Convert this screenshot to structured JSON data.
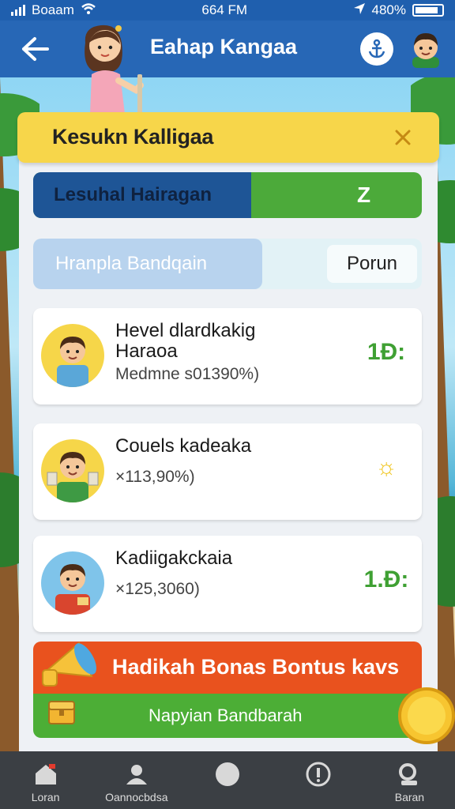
{
  "status_bar": {
    "carrier": "Boaam",
    "time": "664 FM",
    "battery": "480%"
  },
  "header": {
    "title": "Eahap Kangaa",
    "back_icon": "arrow-left-icon",
    "action_icon": "anchor-icon",
    "profile_icon": "boy-avatar-icon"
  },
  "panel": {
    "title": "Kesukn Kalligaa",
    "close_icon": "close-icon",
    "progress_primary": {
      "label": "Lesuhal Hairagan",
      "value": "Z",
      "fill_fraction": 0.56,
      "colors": {
        "fill": "#1e5596",
        "track": "#4caa3a"
      }
    },
    "progress_secondary": {
      "label": "Hranpla Bandqain",
      "button": "Porun",
      "fill_fraction": 0.59
    }
  },
  "items": [
    {
      "name": "Hevel dlardkakig Haraoa",
      "meta": "Medmne s01390%)",
      "badge": "1Đ:",
      "badge_color": "#3fa033",
      "avatar": "boy-blue-shirt-icon"
    },
    {
      "name": "Couels kadeaka",
      "meta": "×113,90%)",
      "badge": "☼",
      "badge_color": "#f0c51e",
      "avatar": "boy-holding-cards-icon"
    },
    {
      "name": "Kadiigakckaia",
      "meta": "×125,3060)",
      "badge": "1.Đ:",
      "badge_color": "#3fa033",
      "avatar": "boy-red-shirt-icon"
    }
  ],
  "bonus": {
    "title": "Hadikah Bonas Bontus kavs",
    "subtitle": "Napyian Bandbarah"
  },
  "nav": [
    {
      "label": "Loran",
      "icon": "home-icon"
    },
    {
      "label": "Oannocbdsa",
      "icon": "user-icon"
    },
    {
      "label": "",
      "icon": "compass-icon"
    },
    {
      "label": "",
      "icon": "info-icon"
    },
    {
      "label": "Baran",
      "icon": "search-icon"
    }
  ]
}
